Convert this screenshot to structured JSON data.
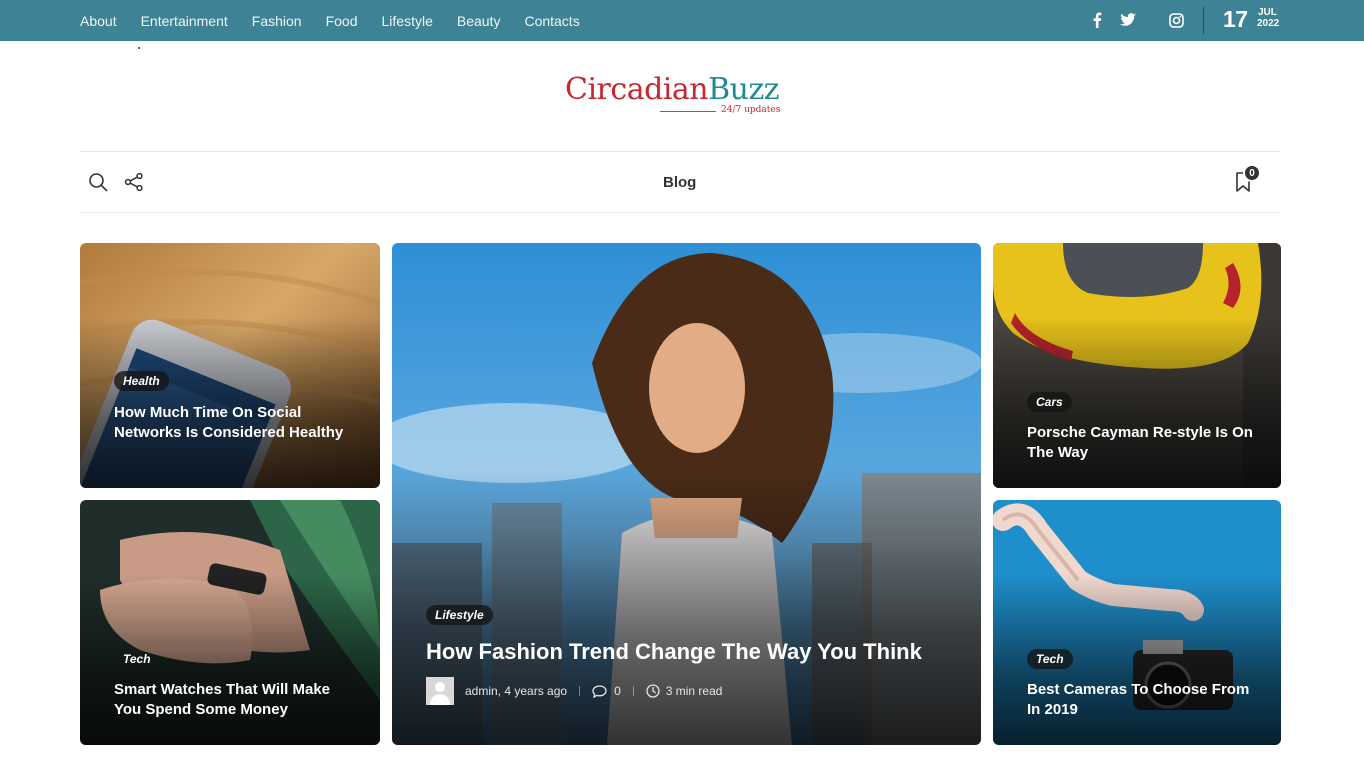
{
  "top_nav": {
    "items": [
      "About",
      "Entertainment",
      "Fashion",
      "Food",
      "Lifestyle",
      "Beauty",
      "Contacts"
    ]
  },
  "social_icons": [
    "facebook-icon",
    "twitter-icon",
    "instagram-icon"
  ],
  "date": {
    "day": "17",
    "month": "JUL",
    "year": "2022"
  },
  "logo": {
    "part1": "Circadian",
    "part2": "Buzz",
    "tagline": "24/7 updates"
  },
  "secondary_bar": {
    "title": "Blog",
    "bookmark_count": "0",
    "icons": [
      "search-icon",
      "share-icon",
      "bookmark-icon"
    ]
  },
  "colors": {
    "topbar": "#3d8295",
    "logo_red": "#c7272f",
    "logo_teal": "#1f8a91"
  },
  "posts": {
    "left_top": {
      "category": "Health",
      "title": "How Much Time On Social Networks Is Considered Healthy"
    },
    "left_bottom": {
      "category": "Tech",
      "title": "Smart Watches That Will Make You Spend Some Money"
    },
    "hero": {
      "category": "Lifestyle",
      "title": "How Fashion Trend Change The Way You Think",
      "author": "admin, 4 years ago",
      "comments": "0",
      "read_time": "3 min read"
    },
    "right_top": {
      "category": "Cars",
      "title": "Porsche Cayman Re-style Is On The Way"
    },
    "right_bottom": {
      "category": "Tech",
      "title": "Best Cameras To Choose From In 2019"
    }
  }
}
